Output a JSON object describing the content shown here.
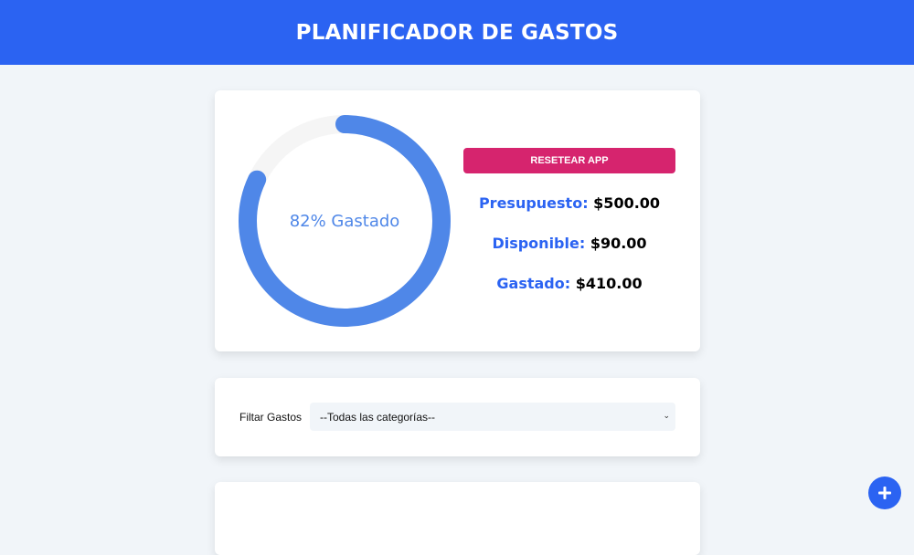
{
  "header": {
    "title": "PLANIFICADOR DE GASTOS"
  },
  "budget": {
    "progress_percent": 82,
    "progress_label": "82% Gastado",
    "reset_label": "RESETEAR APP",
    "stats": [
      {
        "key": "Presupuesto:",
        "value": "$500.00"
      },
      {
        "key": "Disponible:",
        "value": "$90.00"
      },
      {
        "key": "Gastado:",
        "value": "$410.00"
      }
    ]
  },
  "filter": {
    "label": "Filtar Gastos",
    "selected": "--Todas las categorías--"
  },
  "fab": {
    "icon": "plus-icon"
  },
  "colors": {
    "primary": "#2b63f2",
    "progress": "#4f87e8",
    "track": "#f5f5f5",
    "reset": "#d6246e"
  }
}
